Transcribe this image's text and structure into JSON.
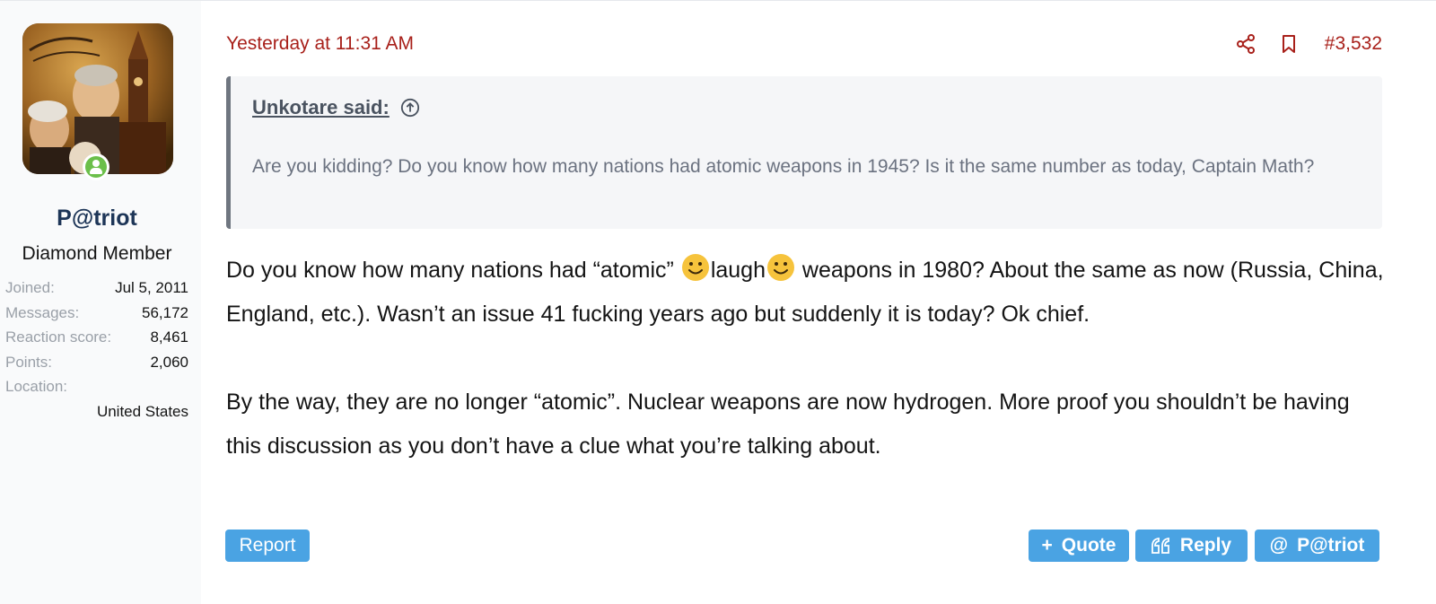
{
  "user": {
    "name": "P@triot",
    "title": "Diamond Member",
    "avatar_alt": "We the People",
    "stats": [
      {
        "label": "Joined:",
        "value": "Jul 5, 2011"
      },
      {
        "label": "Messages:",
        "value": "56,172"
      },
      {
        "label": "Reaction score:",
        "value": "8,461"
      },
      {
        "label": "Points:",
        "value": "2,060"
      }
    ],
    "location_label": "Location:",
    "location_value": "United States"
  },
  "post": {
    "timestamp": "Yesterday at 11:31 AM",
    "number": "#3,532",
    "quote": {
      "author": "Unkotare said:",
      "text": "Are you kidding? Do you know how many nations had atomic weapons in 1945? Is it the same number as today, Captain Math?"
    },
    "body": {
      "p1_a": "Do you know how many nations had “atomic” ",
      "p1_b": "laugh",
      "p1_c": " weapons in 1980? About the same as now (Russia, China, England, etc.). Wasn’t an issue 41 fucking years ago but suddenly it is today? Ok chief.",
      "p2": "By the way, they are no longer “atomic”. Nuclear weapons are now hydrogen. More proof you shouldn’t be having this discussion as you don’t have a clue what you’re talking about."
    }
  },
  "actions": {
    "report": "Report",
    "quote": "Quote",
    "reply": "Reply",
    "mention": "P@triot"
  },
  "colors": {
    "accent_red": "#a8201a",
    "button_blue": "#4aa3e3",
    "username_navy": "#1d3557"
  },
  "icons": {
    "share": "share-icon",
    "bookmark": "bookmark-icon",
    "jump_up": "arrow-up-circle-icon",
    "smiley": "smiley-icon",
    "plus": "plus-icon",
    "reply": "quote-marks-icon",
    "mention": "at-icon",
    "online": "online-user-icon"
  }
}
